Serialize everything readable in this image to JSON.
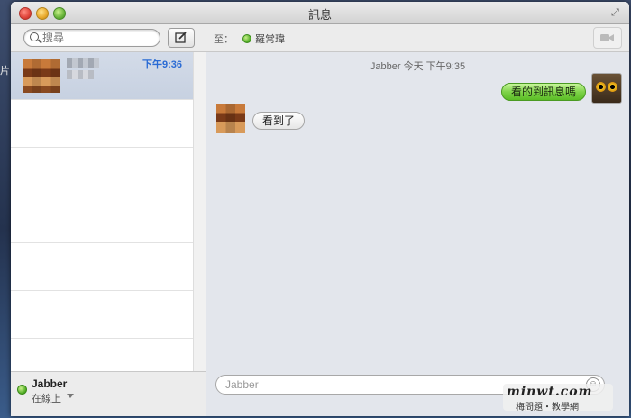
{
  "window": {
    "title": "訊息"
  },
  "desktop": {
    "edge_text": "片"
  },
  "sidebar": {
    "search": {
      "placeholder": "搜尋"
    },
    "conversations": [
      {
        "time": "下午9:36",
        "selected": true
      },
      {
        "time": "",
        "selected": false
      },
      {
        "time": "",
        "selected": false
      },
      {
        "time": "",
        "selected": false
      },
      {
        "time": "",
        "selected": false
      },
      {
        "time": "",
        "selected": false
      },
      {
        "time": "",
        "selected": false
      }
    ],
    "account": {
      "name": "Jabber",
      "status": "在線上"
    }
  },
  "chat": {
    "to_label": "至：",
    "recipient": "羅常瑋",
    "timestamp": "Jabber 今天 下午9:35",
    "outgoing_message": "看的到訊息嗎",
    "incoming_message": "看到了",
    "input_placeholder": "Jabber"
  },
  "watermark": {
    "main": "minwt.com",
    "sub": "梅問題・教學網"
  },
  "colors": {
    "accent_time": "#2a6bd4",
    "bubble_green": "#5bbd26",
    "online_green": "#4caa22"
  }
}
